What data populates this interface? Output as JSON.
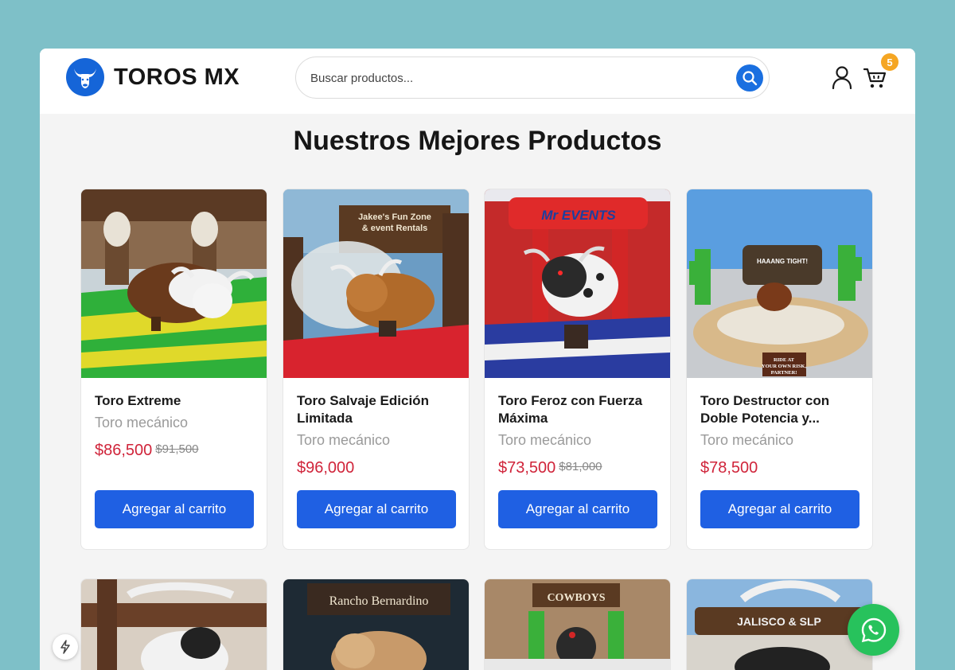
{
  "header": {
    "brand": "TOROS MX",
    "search_placeholder": "Buscar productos...",
    "cart_count": "5"
  },
  "section": {
    "title": "Nuestros Mejores Productos"
  },
  "products": [
    {
      "name": "Toro Extreme",
      "category": "Toro mecánico",
      "price": "$86,500",
      "old_price": "$91,500",
      "button": "Agregar al carrito"
    },
    {
      "name": "Toro Salvaje Edición Limitada",
      "category": "Toro mecánico",
      "price": "$96,000",
      "old_price": "",
      "button": "Agregar al carrito"
    },
    {
      "name": "Toro Feroz con Fuerza Máxima",
      "category": "Toro mecánico",
      "price": "$73,500",
      "old_price": "$81,000",
      "button": "Agregar al carrito"
    },
    {
      "name": "Toro Destructor con Doble Potencia y...",
      "category": "Toro mecánico",
      "price": "$78,500",
      "old_price": "",
      "button": "Agregar al carrito"
    }
  ],
  "image_signs": {
    "p2": "Jakee's Fun Zone & event Rentals",
    "p3": "Mr EVENTS",
    "p4_top": "HAAANG TIGHT!",
    "p4_sign": "RIDE AT YOUR OWN RISK, PARTNER!",
    "p6": "Rancho Bernardino",
    "p7": "COWBOYS",
    "p8": "JALISCO & SLP"
  },
  "colors": {
    "brand": "#1565d8",
    "price": "#d0243a",
    "button": "#1f60e3",
    "badge": "#f5a623",
    "whatsapp": "#27c25c"
  }
}
